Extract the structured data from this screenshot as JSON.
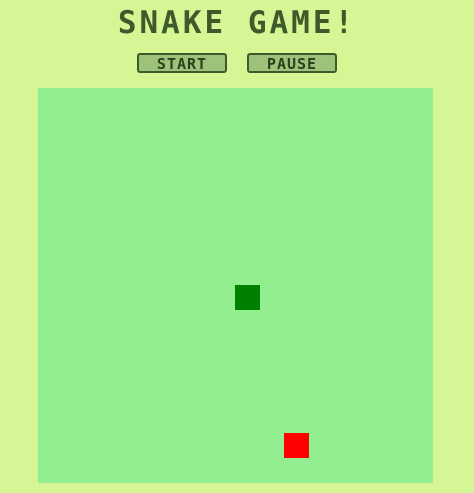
{
  "header": {
    "title": "SNAKE GAME!"
  },
  "controls": {
    "start_label": "START",
    "pause_label": "PAUSE"
  },
  "colors": {
    "background": "#d6f594",
    "board": "#93ee8f",
    "snake": "#008000",
    "food": "#ff0000",
    "text": "#3d5a2a"
  }
}
